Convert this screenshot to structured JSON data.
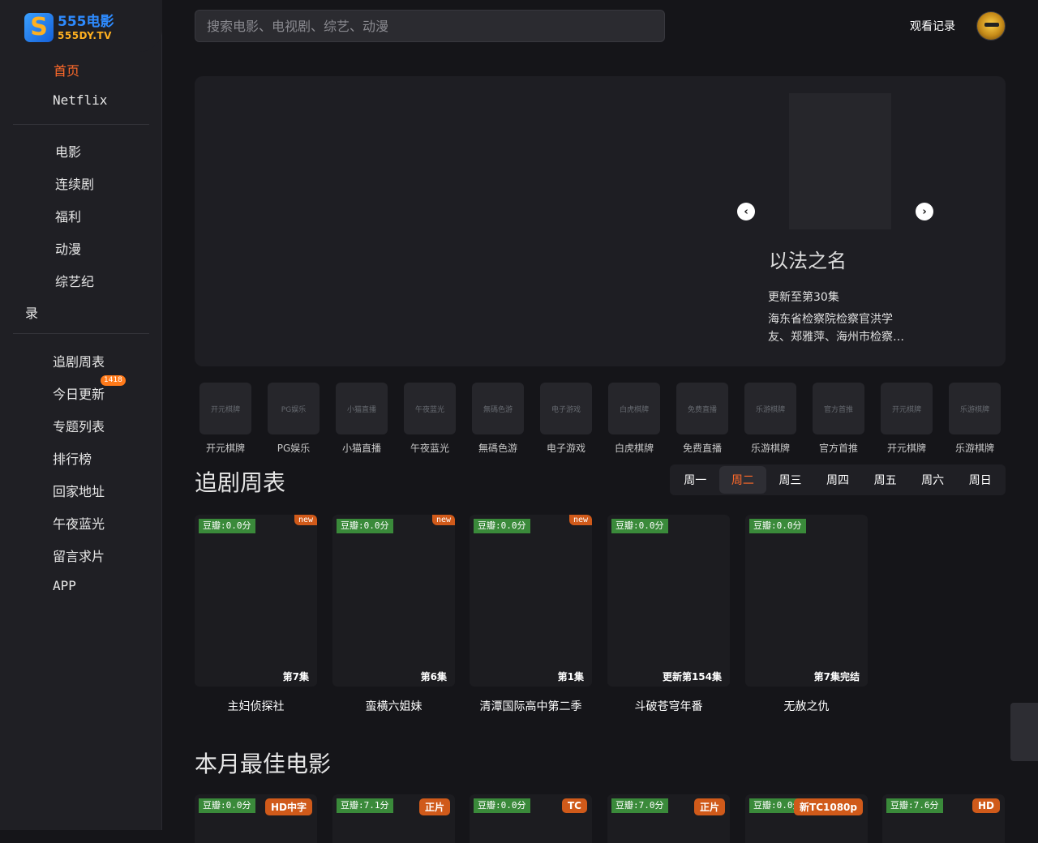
{
  "logo": {
    "mark": "S",
    "title": "555电影",
    "subtitle": "555DY.TV"
  },
  "nav": {
    "primary": [
      {
        "label": "首页",
        "active": true
      },
      {
        "label": "Netflix",
        "active": false
      }
    ],
    "categories": [
      "电影",
      "连续剧",
      "福利",
      "动漫",
      "综艺纪",
      "录"
    ],
    "links": [
      "追剧周表",
      "今日更新",
      "专题列表",
      "排行榜",
      "回家地址",
      "午夜蓝光",
      "留言求片",
      "APP"
    ],
    "today_badge": "1418"
  },
  "header": {
    "search_placeholder": "搜索电影、电视剧、综艺、动漫",
    "history_label": "观看记录"
  },
  "banner": {
    "title": "以法之名",
    "update": "更新至第30集",
    "description": "海东省检察院检察官洪学友、郑雅萍、海州市检察…",
    "prev_icon": "‹",
    "next_icon": "›"
  },
  "ads": [
    {
      "box": "开元棋牌",
      "label": "开元棋牌"
    },
    {
      "box": "PG娱乐",
      "label": "PG娱乐"
    },
    {
      "box": "小猫直播",
      "label": "小猫直播"
    },
    {
      "box": "午夜蓝光",
      "label": "午夜蓝光"
    },
    {
      "box": "無碼色游",
      "label": "無碼色游"
    },
    {
      "box": "电子游戏",
      "label": "电子游戏"
    },
    {
      "box": "白虎棋牌",
      "label": "白虎棋牌"
    },
    {
      "box": "免费直播",
      "label": "免费直播"
    },
    {
      "box": "乐游棋牌",
      "label": "乐游棋牌"
    },
    {
      "box": "官方首推",
      "label": "官方首推"
    },
    {
      "box": "开元棋牌",
      "label": "开元棋牌"
    },
    {
      "box": "乐游棋牌",
      "label": "乐游棋牌"
    }
  ],
  "schedule": {
    "title": "追剧周表",
    "days": [
      "周一",
      "周二",
      "周三",
      "周四",
      "周五",
      "周六",
      "周日"
    ],
    "active_day": "周二",
    "cards": [
      {
        "score": "豆瓣:0.0分",
        "tag": "new",
        "episode": "第7集",
        "title": "主妇侦探社"
      },
      {
        "score": "豆瓣:0.0分",
        "tag": "new",
        "episode": "第6集",
        "title": "蛮横六姐妹"
      },
      {
        "score": "豆瓣:0.0分",
        "tag": "new",
        "episode": "第1集",
        "title": "清潭国际高中第二季"
      },
      {
        "score": "豆瓣:0.0分",
        "tag": "",
        "episode": "更新第154集",
        "title": "斗破苍穹年番"
      },
      {
        "score": "豆瓣:0.0分",
        "tag": "",
        "episode": "第7集完结",
        "title": "无赦之仇"
      }
    ]
  },
  "best_movies": {
    "title": "本月最佳电影",
    "cards": [
      {
        "score": "豆瓣:0.0分",
        "quality": "HD中字"
      },
      {
        "score": "豆瓣:7.1分",
        "quality": "正片"
      },
      {
        "score": "豆瓣:0.0分",
        "quality": "TC"
      },
      {
        "score": "豆瓣:7.0分",
        "quality": "正片"
      },
      {
        "score": "豆瓣:0.0分",
        "quality": "新TC1080p"
      },
      {
        "score": "豆瓣:7.6分",
        "quality": "HD"
      }
    ]
  },
  "colors": {
    "accent": "#ff6a2a",
    "score_green": "#3a8a3a",
    "tag_orange": "#d05a1a",
    "background": "#151519"
  }
}
